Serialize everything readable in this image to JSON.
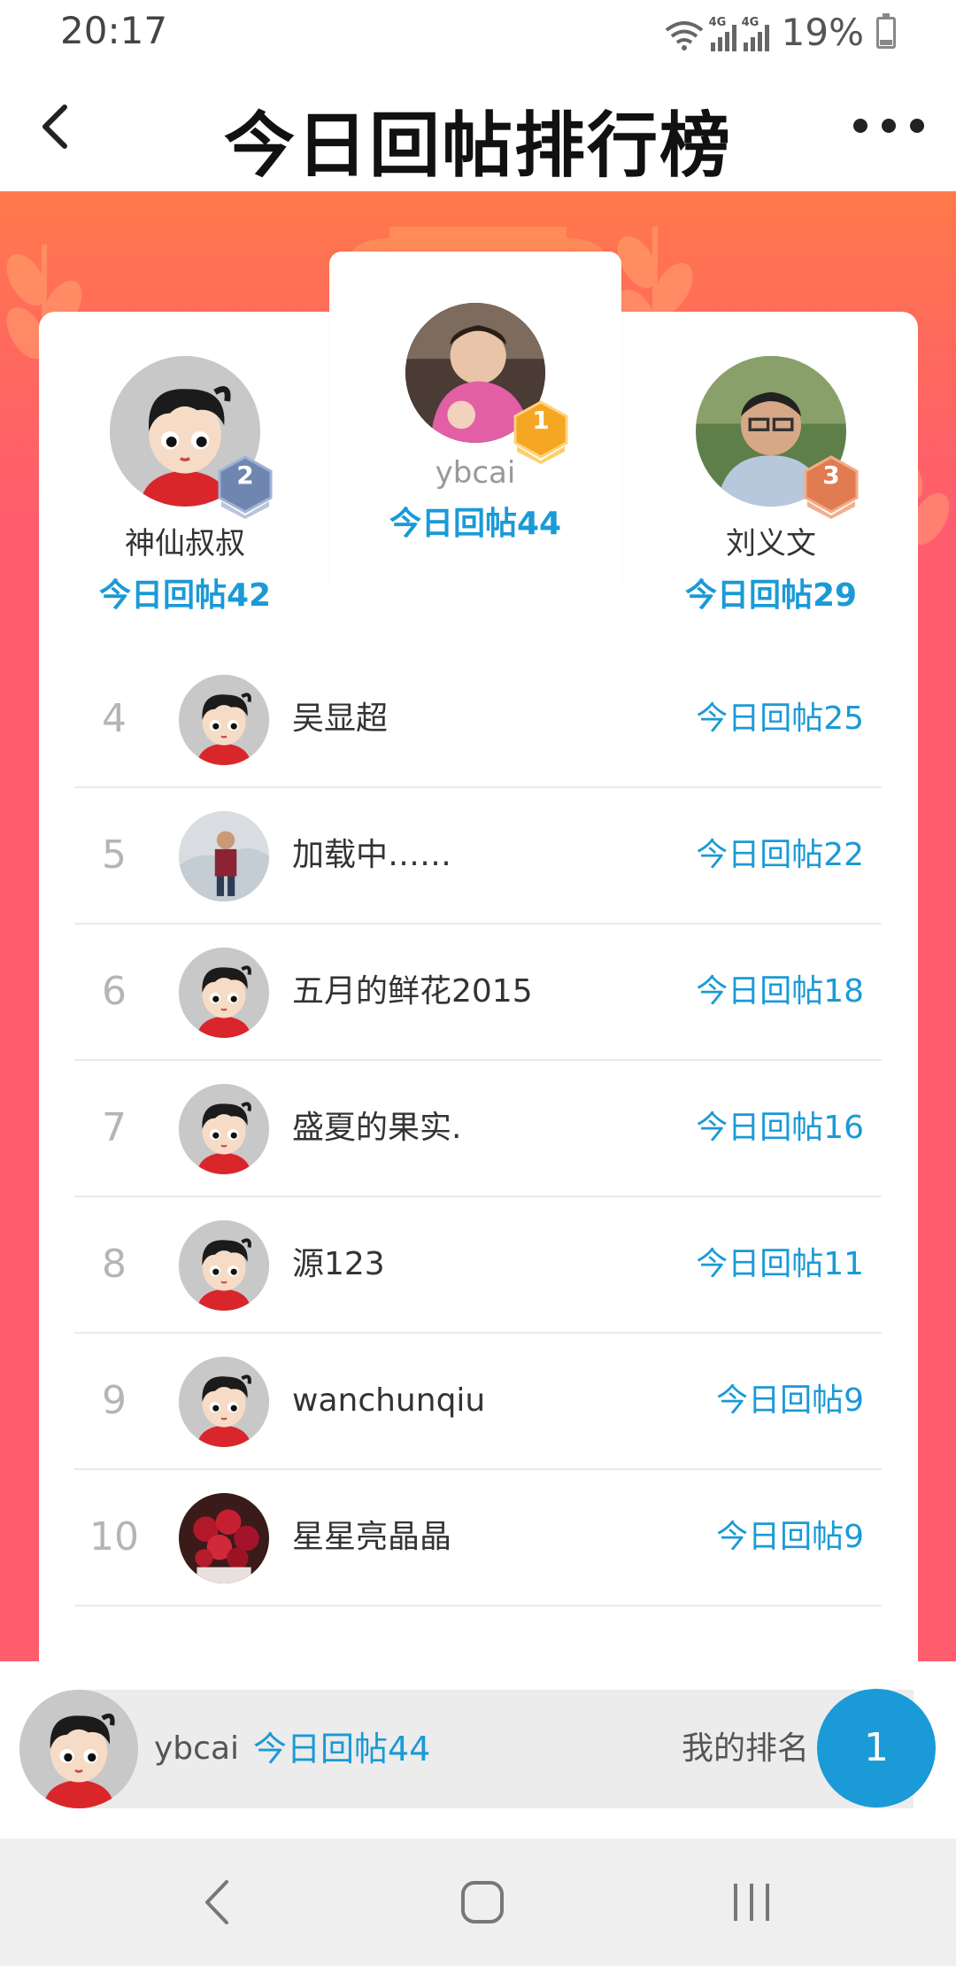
{
  "status_bar": {
    "time": "20:17",
    "signal_label_1": "4G",
    "signal_label_2": "4G",
    "battery_percent": "19%"
  },
  "header": {
    "title": "今日回帖排行榜",
    "back_icon": "chevron-left-icon",
    "more_icon": "more-dots-icon"
  },
  "podium": {
    "first": {
      "rank": "1",
      "name": "ybcai",
      "score": "今日回帖44"
    },
    "second": {
      "rank": "2",
      "name": "神仙叔叔",
      "score": "今日回帖42"
    },
    "third": {
      "rank": "3",
      "name": "刘义文",
      "score": "今日回帖29"
    }
  },
  "list": [
    {
      "rank": "4",
      "name": "吴显超",
      "score": "今日回帖25"
    },
    {
      "rank": "5",
      "name": "加载中……",
      "score": "今日回帖22"
    },
    {
      "rank": "6",
      "name": "五月的鲜花2015",
      "score": "今日回帖18"
    },
    {
      "rank": "7",
      "name": "盛夏的果实.",
      "score": "今日回帖16"
    },
    {
      "rank": "8",
      "name": "源123",
      "score": "今日回帖11"
    },
    {
      "rank": "9",
      "name": "wanchunqiu",
      "score": "今日回帖9"
    },
    {
      "rank": "10",
      "name": "星星亮晶晶",
      "score": "今日回帖9"
    }
  ],
  "my_rank": {
    "name": "ybcai",
    "score": "今日回帖44",
    "label": "我的排名",
    "rank": "1"
  },
  "colors": {
    "accent_blue": "#1a9ad6",
    "banner_pink": "#ff5d6d",
    "gold_badge": "#f5a623",
    "silver_badge": "#6f86b0",
    "bronze_badge": "#e07b52"
  }
}
